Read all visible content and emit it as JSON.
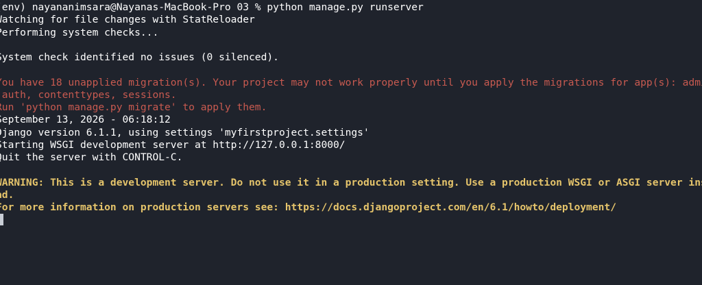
{
  "terminal": {
    "prompt": "(env) nayananimsara@Nayanas-MacBook-Pro 03 % python manage.py runserver",
    "watching": "Watching for file changes with StatReloader",
    "performing": "Performing system checks...",
    "system_check": "System check identified no issues (0 silenced).",
    "migrations_line1": "You have 18 unapplied migration(s). Your project may not work properly until you apply the migrations for app(s): admin,",
    "migrations_line2": " auth, contenttypes, sessions.",
    "migrate_hint": "Run 'python manage.py migrate' to apply them.",
    "date": "September 13, 2026 - 06:18:12",
    "django_version": "Django version 6.1.1, using settings 'myfirstproject.settings'",
    "starting_server": "Starting WSGI development server at http://127.0.0.1:8000/",
    "quit_hint": "Quit the server with CONTROL-C.",
    "warning_line1": "WARNING: This is a development server. Do not use it in a production setting. Use a production WSGI or ASGI server inste",
    "warning_line2": "ad.",
    "more_info": "For more information on production servers see: https://docs.djangoproject.com/en/6.1/howto/deployment/"
  },
  "colors": {
    "background": "#1f232c",
    "text": "#ffffff",
    "error": "#c85a50",
    "warning": "#e5c46b"
  }
}
